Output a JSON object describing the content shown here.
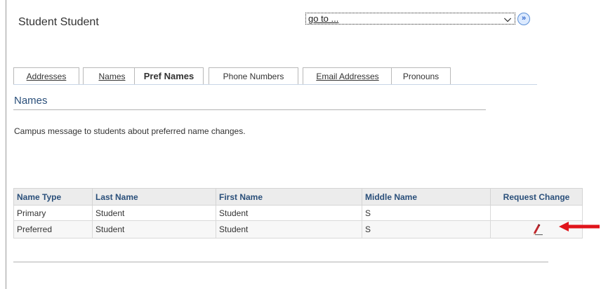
{
  "header": {
    "student_name": "Student Student"
  },
  "goto": {
    "value": "go to ...",
    "caret": "⌵",
    "button_glyph": "»"
  },
  "tabs": [
    {
      "label": "Addresses",
      "active": false
    },
    {
      "label": "Names",
      "active": false
    },
    {
      "label": "Pref Names",
      "active": true
    },
    {
      "label": "Phone Numbers",
      "active": false
    },
    {
      "label": "Email Addresses",
      "active": false
    },
    {
      "label": "Pronouns",
      "active": false
    }
  ],
  "section": {
    "title": "Names",
    "message": "Campus message to students about preferred name changes."
  },
  "grid": {
    "headers": [
      "Name Type",
      "Last Name",
      "First Name",
      "Middle Name",
      "Request Change"
    ],
    "rows": [
      {
        "type": "Primary",
        "last": "Student",
        "first": "Student",
        "middle": "S",
        "editable": false
      },
      {
        "type": "Preferred",
        "last": "Student",
        "first": "Student",
        "middle": "S",
        "editable": true
      }
    ]
  },
  "colors": {
    "accent": "#2a4f7a",
    "arrow": "#e0141b"
  },
  "icons": {
    "edit": "pencil-icon",
    "pointer": "arrow-left-icon"
  }
}
